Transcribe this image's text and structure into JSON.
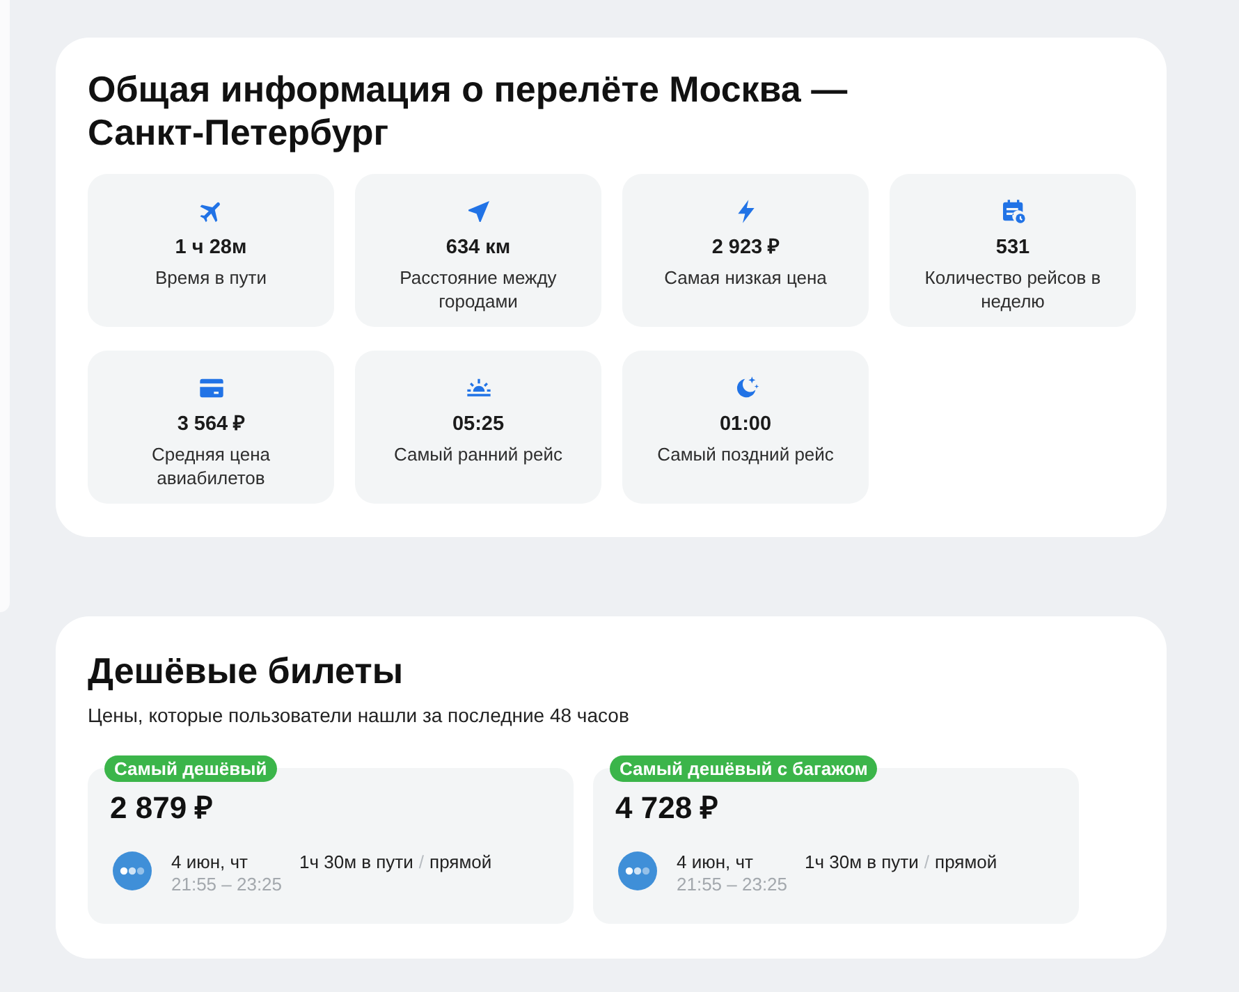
{
  "overview": {
    "title": "Общая информация о перелёте Москва — Санкт-Петербург",
    "stats": [
      {
        "value": "1 ч 28м",
        "label": "Время в пути"
      },
      {
        "value": "634 км",
        "label": "Расстояние между городами"
      },
      {
        "value": "2 923 ₽",
        "label": "Самая низкая цена"
      },
      {
        "value": "531",
        "label": "Количество рейсов в неделю"
      },
      {
        "value": "3 564 ₽",
        "label": "Средняя цена авиабилетов"
      },
      {
        "value": "05:25",
        "label": "Самый ранний рейс"
      },
      {
        "value": "01:00",
        "label": "Самый поздний рейс"
      }
    ]
  },
  "cheap_tickets": {
    "title": "Дешёвые билеты",
    "subtitle": "Цены, которые пользователи нашли за последние 48 часов",
    "tickets": [
      {
        "badge": "Самый дешёвый",
        "price": "2 879 ₽",
        "date": "4 июн, чт",
        "times": "21:55 – 23:25",
        "duration": "1ч 30м в пути",
        "separator": "/",
        "stops": "прямой"
      },
      {
        "badge": "Самый дешёвый с багажом",
        "price": "4 728 ₽",
        "date": "4 июн, чт",
        "times": "21:55 – 23:25",
        "duration": "1ч 30м в пути",
        "separator": "/",
        "stops": "прямой"
      }
    ]
  }
}
